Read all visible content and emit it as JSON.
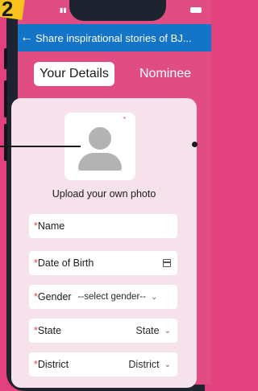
{
  "badge": {
    "number": "2"
  },
  "appbar": {
    "title": "Share inspirational stories of BJ..."
  },
  "tabs": [
    {
      "label": "Your Details",
      "active": true
    },
    {
      "label": "Nominee",
      "active": false
    }
  ],
  "photo": {
    "upload_label": "Upload your own photo",
    "required_mark": "*"
  },
  "form": {
    "required_mark": "*",
    "name_label": "Name",
    "dob_label": "Date of Birth",
    "gender_label": "Gender",
    "gender_value": "--select gender--",
    "state_label": "State",
    "state_value": "State",
    "district_label": "District",
    "district_value": "District"
  },
  "colors": {
    "background": "#e2417e",
    "appbar": "#1474c7",
    "card": "#f6e2ea",
    "required": "#e0454c",
    "badge": "#f6c21b"
  },
  "icons": {
    "back": "back-arrow-icon",
    "calendar": "calendar-icon",
    "chevron": "chevron-down-icon",
    "avatar": "avatar-placeholder-icon"
  }
}
